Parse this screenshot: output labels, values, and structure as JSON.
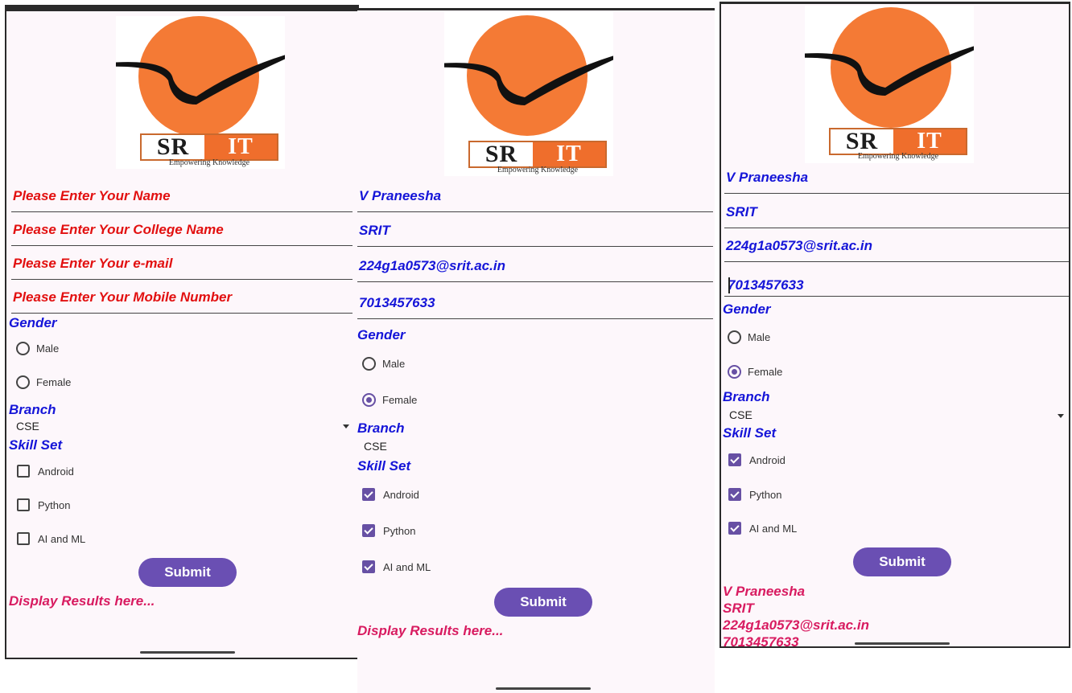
{
  "logo": {
    "brand_left": "SR",
    "brand_right": "IT",
    "tagline": "Empowering Knowledge"
  },
  "screens": [
    {
      "fields": [
        "Please Enter Your Name",
        "Please Enter Your College Name",
        "Please Enter Your e-mail",
        "Please Enter Your Mobile Number"
      ],
      "gender_label": "Gender",
      "gender_options": [
        "Male",
        "Female"
      ],
      "gender_selected": "",
      "branch_label": "Branch",
      "branch_value": "CSE",
      "skill_label": "Skill Set",
      "skills": [
        "Android",
        "Python",
        "AI and ML"
      ],
      "skills_checked": [
        false,
        false,
        false
      ],
      "submit_label": "Submit",
      "result": [
        "Display Results here..."
      ]
    },
    {
      "fields": [
        "V Praneesha",
        "SRIT",
        "224g1a0573@srit.ac.in",
        "7013457633"
      ],
      "gender_label": "Gender",
      "gender_options": [
        "Male",
        "Female"
      ],
      "gender_selected": "Female",
      "branch_label": "Branch",
      "branch_value": "CSE",
      "skill_label": "Skill Set",
      "skills": [
        "Android",
        "Python",
        "AI and ML"
      ],
      "skills_checked": [
        true,
        true,
        true
      ],
      "submit_label": "Submit",
      "result": [
        "Display Results here..."
      ]
    },
    {
      "fields": [
        "V Praneesha",
        "SRIT",
        "224g1a0573@srit.ac.in",
        "7013457633"
      ],
      "gender_label": "Gender",
      "gender_options": [
        "Male",
        "Female"
      ],
      "gender_selected": "Female",
      "branch_label": "Branch",
      "branch_value": "CSE",
      "skill_label": "Skill Set",
      "skills": [
        "Android",
        "Python",
        "AI and ML"
      ],
      "skills_checked": [
        true,
        true,
        true
      ],
      "submit_label": "Submit",
      "result": [
        "V Praneesha",
        "SRIT",
        "224g1a0573@srit.ac.in",
        "7013457633"
      ]
    }
  ],
  "colors": {
    "hint": "#e21010",
    "value": "#1515d8",
    "accent": "#6750a4",
    "result": "#d81b60",
    "logo_orange": "#f47a35"
  }
}
